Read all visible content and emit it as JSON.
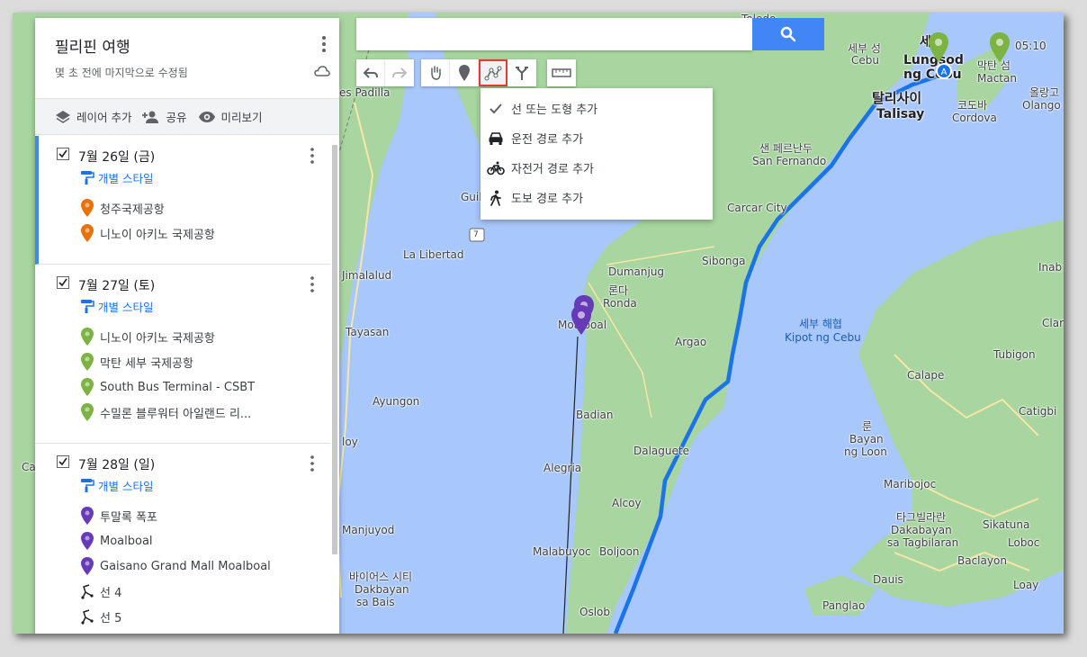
{
  "panel": {
    "title": "필리핀 여행",
    "subtitle": "몇 초 전에 마지막으로 수정됨",
    "actions": {
      "add_layer": "레이어 추가",
      "share": "공유",
      "preview": "미리보기"
    },
    "layers": [
      {
        "title": "7월 26일 (금)",
        "style": "개별 스타일",
        "pin_color": "#e8710a",
        "features": [
          {
            "label": "청주국제공항",
            "kind": "pin"
          },
          {
            "label": "니노이 아키노 국제공항",
            "kind": "pin"
          }
        ]
      },
      {
        "title": "7월 27일 (토)",
        "style": "개별 스타일",
        "pin_color": "#7cb342",
        "features": [
          {
            "label": "니노이 아키노 국제공항",
            "kind": "pin"
          },
          {
            "label": "막탄 세부 국제공항",
            "kind": "pin"
          },
          {
            "label": "South Bus Terminal - CSBT",
            "kind": "pin"
          },
          {
            "label": "수밀론 블루워터 아일랜드 리...",
            "kind": "pin"
          }
        ]
      },
      {
        "title": "7월 28일 (일)",
        "style": "개별 스타일",
        "pin_color": "#673ab7",
        "features": [
          {
            "label": "투말록 폭포",
            "kind": "pin"
          },
          {
            "label": "Moalboal",
            "kind": "pin"
          },
          {
            "label": "Gaisano Grand Mall Moalboal",
            "kind": "pin"
          },
          {
            "label": "선 4",
            "kind": "line"
          },
          {
            "label": "선 5",
            "kind": "line"
          }
        ]
      }
    ]
  },
  "search": {
    "value": "",
    "placeholder": ""
  },
  "toolbar": {
    "undo": "undo-icon",
    "redo": "redo-icon",
    "pan": "hand-icon",
    "marker": "marker-icon",
    "draw_line": "draw-line-icon",
    "directions": "directions-icon",
    "measure": "ruler-icon"
  },
  "draw_menu": [
    {
      "label": "선 또는 도형 추가",
      "icon": "check-icon",
      "selected": true
    },
    {
      "label": "운전 경로 추가",
      "icon": "car-icon",
      "selected": false
    },
    {
      "label": "자전거 경로 추가",
      "icon": "bike-icon",
      "selected": false
    },
    {
      "label": "도보 경로 추가",
      "icon": "walk-icon",
      "selected": false
    }
  ],
  "map_labels": {
    "cebu_ko": "세부 성",
    "cebu": "Cebu",
    "lungsod_a": "세부",
    "lungsod_b": "Lungsod",
    "lungsod_c": "ng Cebu",
    "talisay_ko": "탈리사이",
    "talisay": "Talisay",
    "mactan_ko": "막탄 섬",
    "mactan": "Mactan",
    "cordova_ko": "코도바",
    "cordova": "Cordova",
    "olango_ko": "올랑고",
    "olango": "Olango Is",
    "time": "05:10",
    "san_fernando_ko": "샌 페르난두",
    "san_fernando": "San Fernando",
    "carcar": "Carcar City",
    "sibonga": "Sibonga",
    "dumanjug": "Dumanjug",
    "ronda_ko": "론다",
    "ronda": "Ronda",
    "moalboal": "Moalboal",
    "argao": "Argao",
    "badian": "Badian",
    "dalaguete": "Dalaguete",
    "alegria": "Alegria",
    "alcoy": "Alcoy",
    "malabuyoc": "Malabuyoc",
    "boljoon": "Boljoon",
    "oslob": "Oslob",
    "strait_ko": "세부 해협",
    "strait": "Kipot ng Cebu",
    "calape": "Calape",
    "tubigon": "Tubigon",
    "catigbi": "Catigbi",
    "bayan_ko": "룬",
    "bayan_a": "Bayan",
    "bayan_b": "ng Loon",
    "maribojoc": "Maribojoc",
    "tag_ko": "타그빌라란",
    "tag_a": "Dakabayan",
    "tag_b": "sa Tagbilaran",
    "sikatuna": "Sikatuna",
    "baclayon": "Baclayon",
    "loboc": "Loboc",
    "dauis": "Dauis",
    "panglao": "Panglao",
    "loay": "Loay",
    "bais_ko": "바이어스 시티",
    "bais_a": "Dakbayan",
    "bais_b": "sa Bais",
    "manjuyod": "Manjuyod",
    "ayungon": "Ayungon",
    "tayasan": "Tayasan",
    "jimalalud": "Jimalalud",
    "la_libertad": "La Libertad",
    "guil": "Guil",
    "padilla": "es Padilla",
    "inab": "Inab",
    "clar": "Clar",
    "lloy": "loy",
    "ca": "Ca",
    "toledo": "Toledo",
    "route7": "7"
  },
  "colors": {
    "route": "#1a73e8",
    "land": "#a8d5a0",
    "water": "#a8c7fa",
    "accent": "#4285f4"
  }
}
